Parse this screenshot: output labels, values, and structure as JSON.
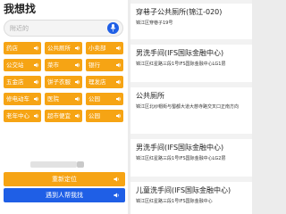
{
  "header": {
    "title": "我想找"
  },
  "search": {
    "placeholder": "附近的",
    "value": ""
  },
  "categories": [
    {
      "label": "药店"
    },
    {
      "label": "公共厕所"
    },
    {
      "label": "小卖部"
    },
    {
      "label": "公交站"
    },
    {
      "label": "菜市"
    },
    {
      "label": "银行"
    },
    {
      "label": "五金店"
    },
    {
      "label": "饼子衣服"
    },
    {
      "label": "理发店"
    },
    {
      "label": "修电动车"
    },
    {
      "label": "医院"
    },
    {
      "label": "公园"
    },
    {
      "label": "老年中心"
    },
    {
      "label": "超市便宜"
    },
    {
      "label": "公园"
    }
  ],
  "buttons": {
    "locate_label": "重新定位",
    "help_label": "遇到人帮我找"
  },
  "results": [
    {
      "name": "穿巷子公共厕所(锦江-020)",
      "address": "锦江区穿巷子19号",
      "distance": ""
    },
    {
      "name": "男洗手间(IFS国际金融中心)",
      "address": "锦江区红星路三段1号IFS国际金融中心LG1层",
      "distance": ""
    },
    {
      "name": "公共厕所",
      "address": "锦江区北纱帽街与蜀都大道大慈寺路交叉口正南方向",
      "distance": ""
    },
    {
      "name": "男洗手间(IFS国际金融中心)",
      "address": "锦江区红星路三段1号IFS国际金融中心LG2层",
      "distance": ""
    },
    {
      "name": "儿童洗手间(IFS国际金融中心)",
      "address": "锦江区红星路三段1号IFS国际金融中心",
      "distance": ""
    }
  ],
  "colors": {
    "accent_orange": "#f6a414",
    "accent_blue": "#1f5fe6"
  }
}
